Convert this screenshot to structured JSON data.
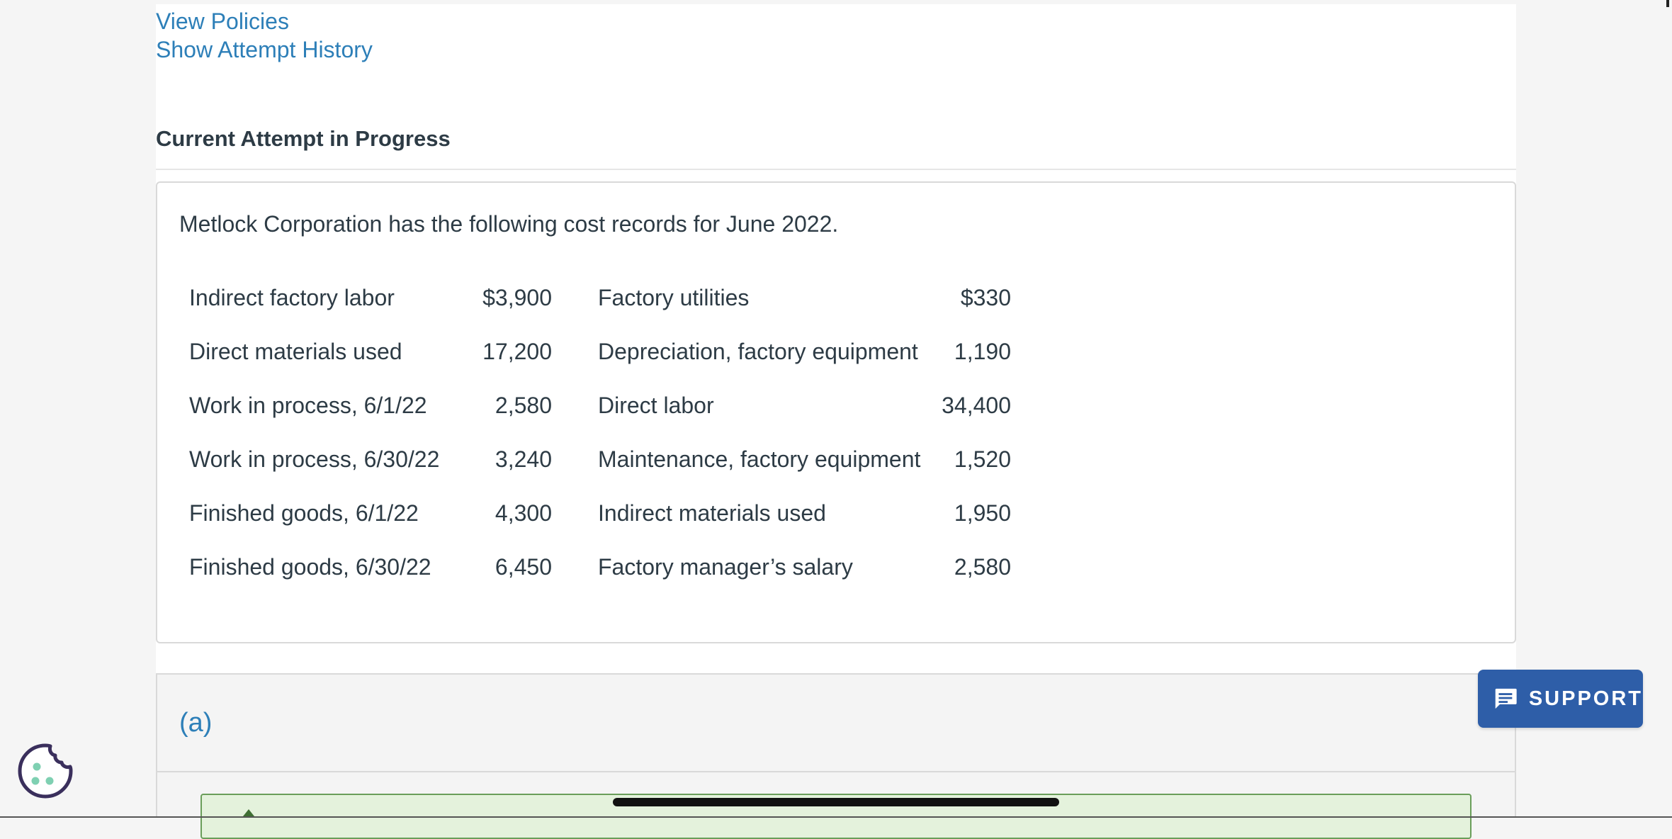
{
  "links": {
    "view_policies": "View Policies",
    "show_attempt_history": "Show Attempt History"
  },
  "attempt": {
    "heading": "Current Attempt in Progress"
  },
  "question": {
    "intro": "Metlock Corporation has the following cost records for June 2022.",
    "rows": [
      {
        "label1": "Indirect factory labor",
        "value1": "$3,900",
        "label2": "Factory utilities",
        "value2": "$330"
      },
      {
        "label1": "Direct materials used",
        "value1": "17,200",
        "label2": "Depreciation, factory equipment",
        "value2": "1,190"
      },
      {
        "label1": "Work in process, 6/1/22",
        "value1": "2,580",
        "label2": "Direct labor",
        "value2": "34,400"
      },
      {
        "label1": "Work in process, 6/30/22",
        "value1": "3,240",
        "label2": "Maintenance, factory equipment",
        "value2": "1,520"
      },
      {
        "label1": "Finished goods, 6/1/22",
        "value1": "4,300",
        "label2": "Indirect materials used",
        "value2": "1,950"
      },
      {
        "label1": "Finished goods, 6/30/22",
        "value1": "6,450",
        "label2": "Factory manager’s salary",
        "value2": "2,580"
      }
    ]
  },
  "part": {
    "label": "(a)"
  },
  "support": {
    "label": "SUPPORT",
    "icon": "chat-icon"
  },
  "cookie": {
    "icon": "cookie-icon"
  },
  "colors": {
    "link": "#2d7fb8",
    "support_bg": "#2e5ea8",
    "green_box_bg": "#e4f2dc"
  }
}
